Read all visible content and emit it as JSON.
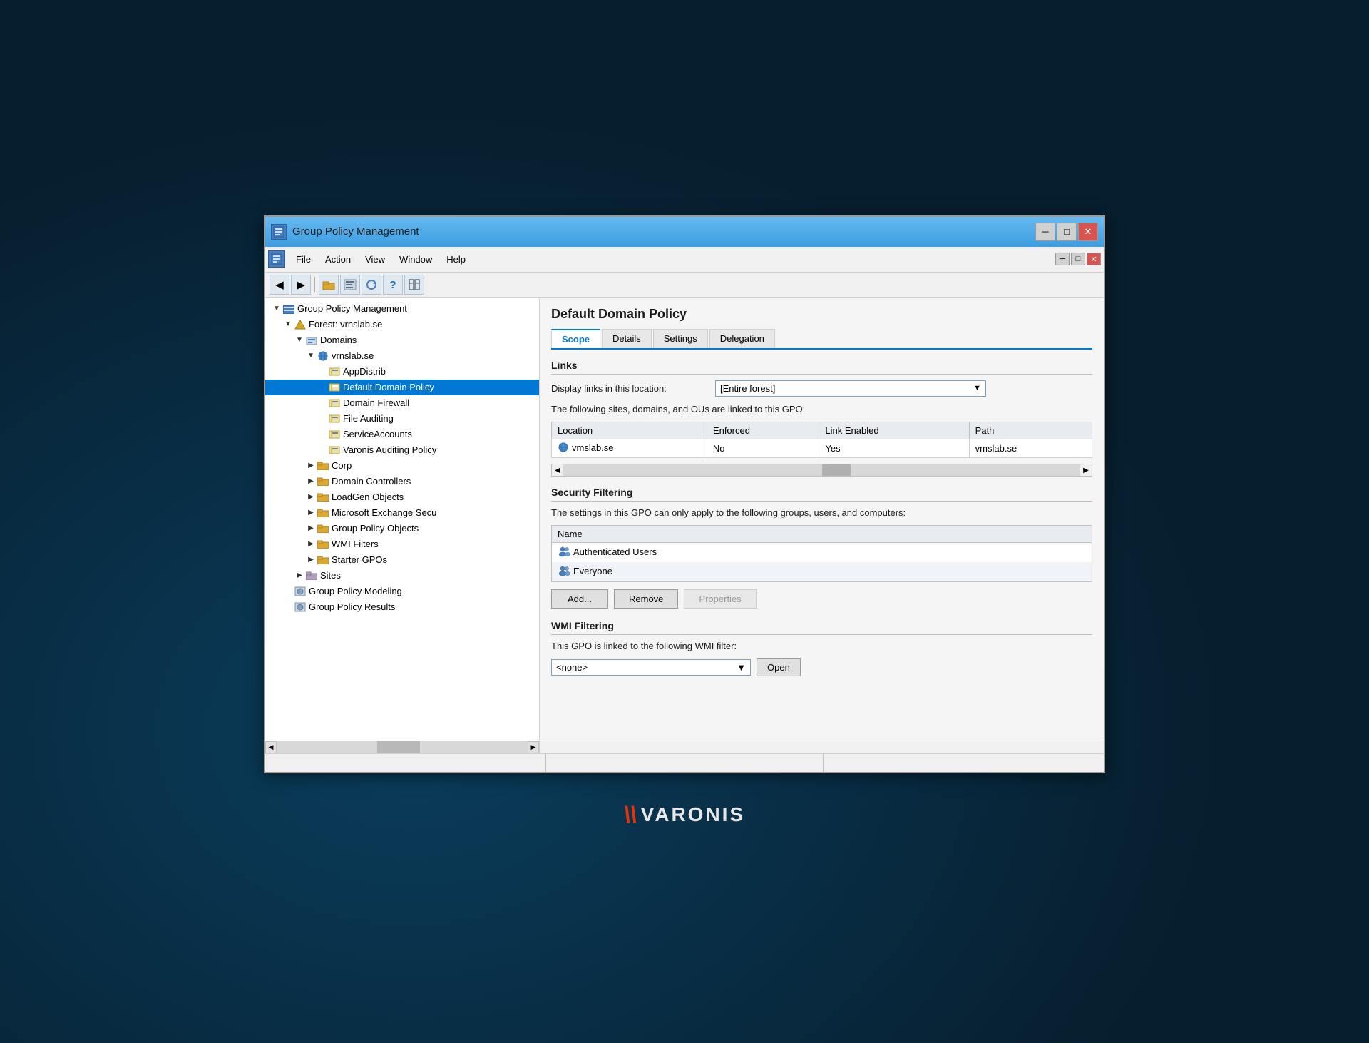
{
  "window": {
    "title": "Group Policy Management",
    "min_btn": "─",
    "max_btn": "□",
    "close_btn": "✕"
  },
  "menubar": {
    "icon_label": "📋",
    "file": "File",
    "action": "Action",
    "view": "View",
    "window": "Window",
    "help": "Help"
  },
  "toolbar": {
    "back": "◀",
    "forward": "▶",
    "up": "📁",
    "console": "📋",
    "refresh": "🔄",
    "help": "?",
    "cols": "⊞"
  },
  "tree": {
    "root": "Group Policy Management",
    "forest_label": "Forest: vrnslab.se",
    "domains_label": "Domains",
    "domain_label": "vrnslab.se",
    "items": [
      {
        "label": "AppDistrib",
        "indent": 4,
        "icon": "gpo"
      },
      {
        "label": "Default Domain Policy",
        "indent": 4,
        "icon": "gpo",
        "selected": true
      },
      {
        "label": "Domain Firewall",
        "indent": 4,
        "icon": "gpo"
      },
      {
        "label": "File Auditing",
        "indent": 4,
        "icon": "gpo"
      },
      {
        "label": "ServiceAccounts",
        "indent": 4,
        "icon": "gpo"
      },
      {
        "label": "Varonis Auditing Policy",
        "indent": 4,
        "icon": "gpo"
      },
      {
        "label": "Corp",
        "indent": 3,
        "icon": "folder",
        "expand": "▶"
      },
      {
        "label": "Domain Controllers",
        "indent": 3,
        "icon": "folder",
        "expand": "▶"
      },
      {
        "label": "LoadGen Objects",
        "indent": 3,
        "icon": "folder",
        "expand": "▶"
      },
      {
        "label": "Microsoft Exchange Secu",
        "indent": 3,
        "icon": "folder",
        "expand": "▶"
      },
      {
        "label": "Group Policy Objects",
        "indent": 3,
        "icon": "folder",
        "expand": "▶"
      },
      {
        "label": "WMI Filters",
        "indent": 3,
        "icon": "folder",
        "expand": "▶"
      },
      {
        "label": "Starter GPOs",
        "indent": 3,
        "icon": "folder",
        "expand": "▶"
      }
    ],
    "sites_label": "Sites",
    "modeling_label": "Group Policy Modeling",
    "results_label": "Group Policy Results"
  },
  "main": {
    "title": "Default Domain Policy",
    "tabs": [
      "Scope",
      "Details",
      "Settings",
      "Delegation"
    ],
    "active_tab": "Scope",
    "links_section": {
      "header": "Links",
      "display_label": "Display links in this location:",
      "dropdown_value": "[Entire forest]",
      "info_text": "The following sites, domains, and OUs are linked to this GPO:",
      "table_headers": [
        "Location",
        "Enforced",
        "Link Enabled",
        "Path"
      ],
      "table_rows": [
        {
          "location": "vmslab.se",
          "enforced": "No",
          "link_enabled": "Yes",
          "path": "vmslab.se"
        }
      ]
    },
    "security_section": {
      "header": "Security Filtering",
      "info_text": "The settings in this GPO can only apply to the following groups, users, and computers:",
      "name_header": "Name",
      "users": [
        {
          "name": "Authenticated Users",
          "selected": false
        },
        {
          "name": "Everyone",
          "selected": false
        }
      ],
      "add_btn": "Add...",
      "remove_btn": "Remove",
      "properties_btn": "Properties"
    },
    "wmi_section": {
      "header": "WMI Filtering",
      "info_text": "This GPO is linked to the following WMI filter:",
      "dropdown_value": "<none>",
      "open_btn": "Open"
    }
  },
  "statusbar": {
    "sections": [
      "",
      "",
      ""
    ]
  },
  "varonis": {
    "v_icon": "\\\\",
    "text": "VARONIS"
  }
}
